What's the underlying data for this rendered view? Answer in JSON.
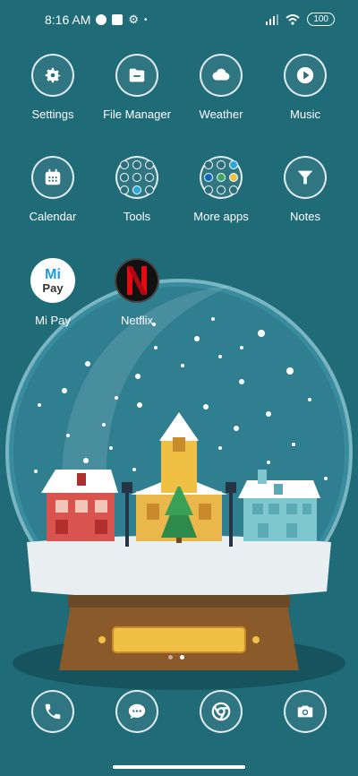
{
  "status_bar": {
    "time": "8:16 AM",
    "battery": "100"
  },
  "apps": [
    {
      "label": "Settings",
      "icon": "gear-icon"
    },
    {
      "label": "File Manager",
      "icon": "folder-icon"
    },
    {
      "label": "Weather",
      "icon": "cloud-icon"
    },
    {
      "label": "Music",
      "icon": "play-icon"
    },
    {
      "label": "Calendar",
      "icon": "calendar-icon"
    },
    {
      "label": "Tools",
      "icon": "folder-grid-icon"
    },
    {
      "label": "More apps",
      "icon": "folder-grid-icon"
    },
    {
      "label": "Notes",
      "icon": "funnel-icon"
    },
    {
      "label": "Mi Pay",
      "icon": "mi-pay-logo"
    },
    {
      "label": "Netflix",
      "icon": "netflix-logo"
    }
  ],
  "mi_pay_logo_text": "Mi Pay",
  "netflix_logo_text": "N",
  "dock": [
    {
      "name": "phone",
      "icon": "phone-icon"
    },
    {
      "name": "messages",
      "icon": "chat-icon"
    },
    {
      "name": "browser",
      "icon": "chrome-icon"
    },
    {
      "name": "camera",
      "icon": "camera-icon"
    }
  ],
  "colors": {
    "background": "#1f6b78",
    "glass_base": "#6b4a2b",
    "plaque": "#f0c045",
    "netflix_red": "#e50914"
  }
}
